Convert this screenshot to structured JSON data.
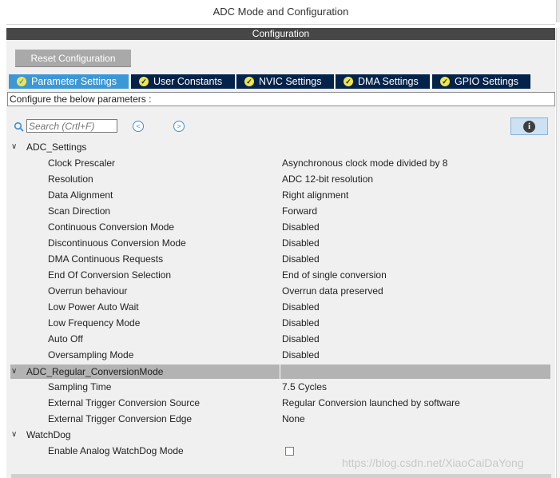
{
  "window": {
    "title": "ADC Mode and Configuration"
  },
  "config_header": "Configuration",
  "toolbar": {
    "reset_label": "Reset Configuration"
  },
  "tabs": [
    {
      "label": "Parameter Settings",
      "active": true
    },
    {
      "label": "User Constants",
      "active": false
    },
    {
      "label": "NVIC Settings",
      "active": false
    },
    {
      "label": "DMA Settings",
      "active": false
    },
    {
      "label": "GPIO Settings",
      "active": false
    }
  ],
  "configure_text": "Configure the below parameters :",
  "search": {
    "placeholder": "Search (Crtl+F)"
  },
  "icons": {
    "search": "search-icon",
    "prev": "arrow-left-circle-icon",
    "next": "arrow-right-circle-icon",
    "info": "info-icon",
    "tab_check": "check-circle-icon"
  },
  "groups": {
    "adc_settings": {
      "label": "ADC_Settings",
      "rows": [
        {
          "name": "Clock Prescaler",
          "value": "Asynchronous clock mode divided by 8"
        },
        {
          "name": "Resolution",
          "value": "ADC 12-bit resolution"
        },
        {
          "name": "Data Alignment",
          "value": "Right alignment"
        },
        {
          "name": "Scan Direction",
          "value": "Forward"
        },
        {
          "name": "Continuous Conversion Mode",
          "value": "Disabled"
        },
        {
          "name": "Discontinuous Conversion Mode",
          "value": "Disabled"
        },
        {
          "name": "DMA Continuous Requests",
          "value": "Disabled"
        },
        {
          "name": "End Of Conversion Selection",
          "value": "End of single conversion"
        },
        {
          "name": "Overrun behaviour",
          "value": "Overrun data preserved"
        },
        {
          "name": "Low Power Auto Wait",
          "value": "Disabled"
        },
        {
          "name": "Low Frequency Mode",
          "value": "Disabled"
        },
        {
          "name": "Auto Off",
          "value": "Disabled"
        },
        {
          "name": "Oversampling Mode",
          "value": "Disabled"
        }
      ]
    },
    "regular_conversion": {
      "label": "ADC_Regular_ConversionMode",
      "rows": [
        {
          "name": "Sampling Time",
          "value": "7.5 Cycles"
        },
        {
          "name": "External Trigger Conversion Source",
          "value": "Regular Conversion launched by software"
        },
        {
          "name": "External Trigger Conversion Edge",
          "value": "None"
        }
      ]
    },
    "watchdog": {
      "label": "WatchDog",
      "rows": [
        {
          "name": "Enable Analog WatchDog Mode",
          "checked": false
        }
      ]
    }
  },
  "watermark": "https://blog.csdn.net/XiaoCaiDaYong",
  "colors": {
    "tab_active": "#3c97d6",
    "tab_inactive": "#03234b",
    "header_bar": "#474747",
    "check": "#f1e54a"
  }
}
